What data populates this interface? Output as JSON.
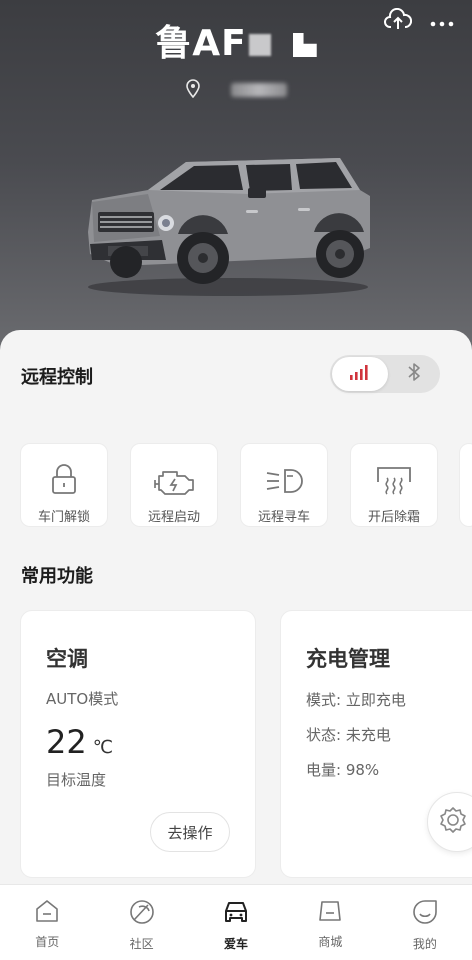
{
  "header": {
    "plate": "鲁AF",
    "icons": [
      "cloud-upload-icon",
      "more-icon",
      "location-pin-icon"
    ]
  },
  "remote": {
    "title": "远程控制",
    "accent": "#d0343c",
    "controls": [
      {
        "label": "车门解锁",
        "icon": "lock-icon"
      },
      {
        "label": "远程启动",
        "icon": "engine-icon"
      },
      {
        "label": "远程寻车",
        "icon": "headlight-icon"
      },
      {
        "label": "开后除霜",
        "icon": "rear-defrost-icon"
      }
    ]
  },
  "common": {
    "title": "常用功能",
    "ac": {
      "title": "空调",
      "mode": "AUTO模式",
      "temp": "22",
      "unit": "℃",
      "temp_label": "目标温度",
      "button": "去操作"
    },
    "charge": {
      "title": "充电管理",
      "mode": "模式: 立即充电",
      "status": "状态: 未充电",
      "battery": "电量: 98%"
    }
  },
  "tabbar": [
    {
      "label": "首页",
      "icon": "home-icon",
      "active": false
    },
    {
      "label": "社区",
      "icon": "community-icon",
      "active": false
    },
    {
      "label": "爱车",
      "icon": "car-icon",
      "active": true
    },
    {
      "label": "商城",
      "icon": "shop-icon",
      "active": false
    },
    {
      "label": "我的",
      "icon": "profile-icon",
      "active": false
    }
  ]
}
